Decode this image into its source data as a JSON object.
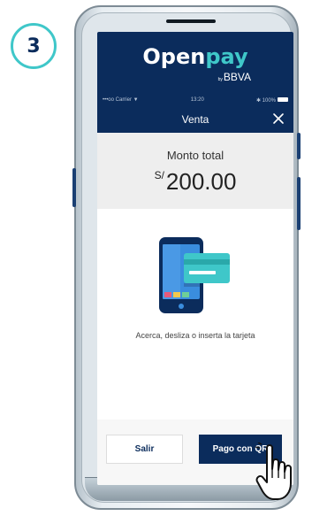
{
  "step": {
    "number": "3"
  },
  "brand": {
    "name_part1": "Open",
    "name_part2": "pay",
    "sub_by": "by",
    "sub_name": "BBVA"
  },
  "status_bar": {
    "carrier": "•••oo Carrier ▼",
    "time": "13:20",
    "battery": "✱ 100%"
  },
  "nav": {
    "title": "Venta"
  },
  "amount": {
    "label": "Monto total",
    "currency": "S/",
    "value": "200.00"
  },
  "instruction": "Acerca, desliza o inserta la tarjeta",
  "buttons": {
    "exit_label": "Salir",
    "qr_label": "Pago con QR"
  },
  "icons": {
    "close": "close-icon",
    "card_reader": "card-phone-icon",
    "hand": "hand-pointer-icon"
  },
  "colors": {
    "brand_navy": "#0b2c5c",
    "accent_teal": "#3fc7c9"
  }
}
